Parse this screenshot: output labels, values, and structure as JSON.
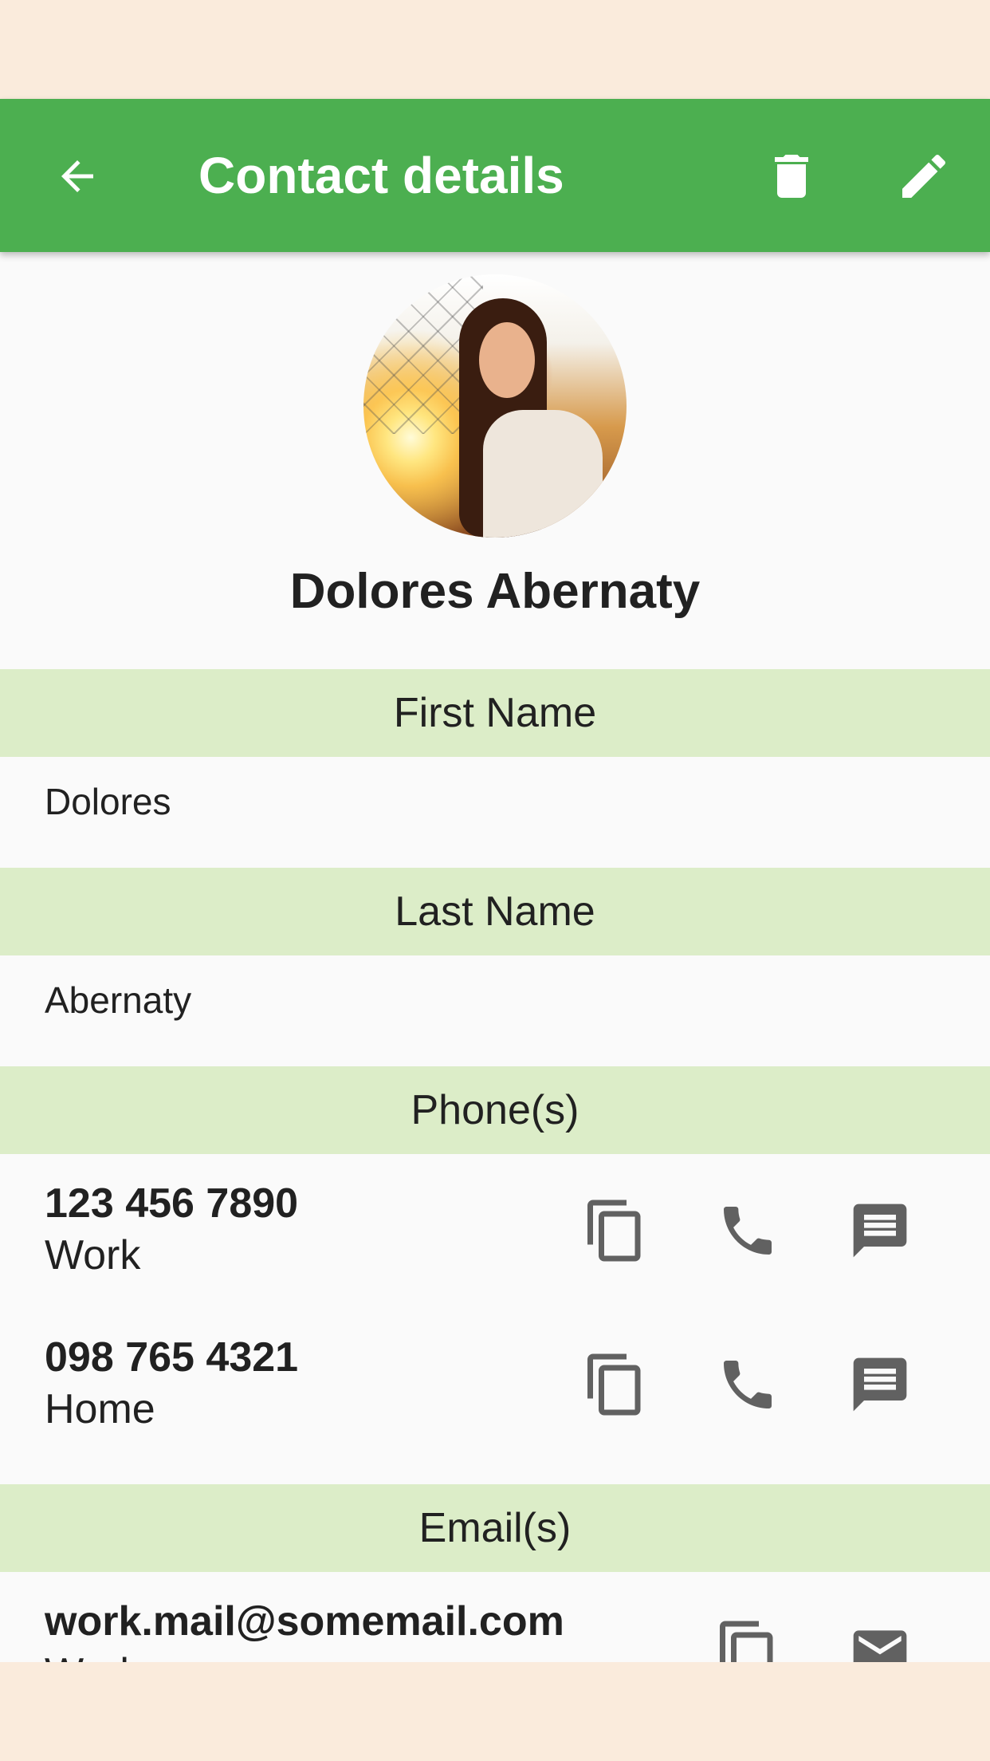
{
  "app_bar": {
    "title": "Contact details",
    "color": "#4CAF50",
    "icons": [
      "arrow-back-icon",
      "delete-icon",
      "edit-icon"
    ]
  },
  "contact": {
    "full_name": "Dolores Abernaty"
  },
  "sections": {
    "first_name": {
      "header": "First Name",
      "value": "Dolores"
    },
    "last_name": {
      "header": "Last Name",
      "value": "Abernaty"
    },
    "phones": {
      "header": "Phone(s)",
      "items": [
        {
          "number": "123 456 7890",
          "label": "Work"
        },
        {
          "number": "098 765 4321",
          "label": "Home"
        }
      ],
      "actions": [
        "copy-icon",
        "phone-icon",
        "message-icon"
      ]
    },
    "emails": {
      "header": "Email(s)",
      "items": [
        {
          "address": "work.mail@somemail.com",
          "label": "Work"
        }
      ],
      "actions": [
        "copy-icon",
        "email-icon"
      ]
    }
  },
  "colors": {
    "section_header_bg": "#DCEDC8",
    "content_bg": "#FAFAFA",
    "icon_color": "#616161",
    "outer_bg": "#FAEBDC"
  }
}
